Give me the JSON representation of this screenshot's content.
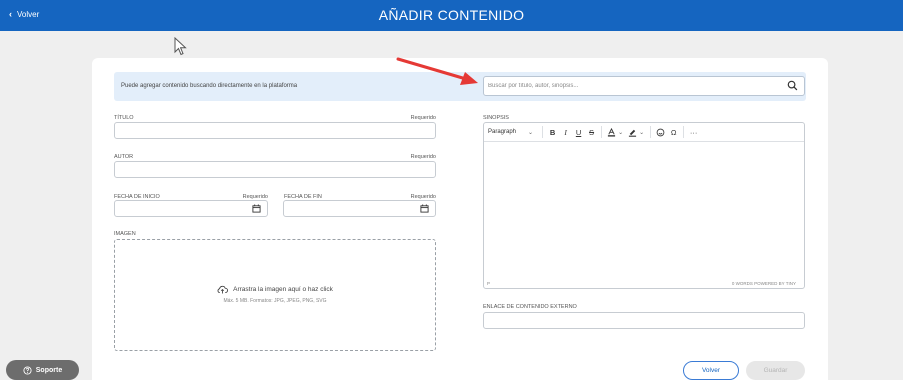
{
  "header": {
    "back_label": "Volver",
    "title": "AÑADIR CONTENIDO"
  },
  "banner": {
    "text": "Puede agregar contenido buscando directamente en la plataforma",
    "search_placeholder": "Buscar por título, autor, sinopsis..."
  },
  "form": {
    "titulo_label": "TÍTULO",
    "autor_label": "AUTOR",
    "fecha_inicio_label": "FECHA DE INICIO",
    "fecha_fin_label": "FECHA DE FIN",
    "imagen_label": "IMAGEN",
    "required_text": "Requerido",
    "sinopsis_label": "SINOPSIS",
    "enlace_label": "ENLACE DE CONTENIDO EXTERNO",
    "dropzone_text": "Arrastra la imagen aquí o haz click",
    "dropzone_hint": "Máx. 5 MB. Formatos: JPG, JPEG, PNG, SVG"
  },
  "editor": {
    "format_select": "Paragraph",
    "bold": "B",
    "italic": "I",
    "underline": "U",
    "strike": "S",
    "omega": "Ω",
    "more": "···",
    "status_path": "P",
    "word_count": "0 WORDS  POWERED BY TINY"
  },
  "actions": {
    "volver_label": "Volver",
    "guardar_label": "Guardar",
    "soporte_label": "Soporte"
  },
  "colors": {
    "header": "#1565c0",
    "banner": "#e3eefa",
    "annotation_arrow": "#e53935"
  }
}
